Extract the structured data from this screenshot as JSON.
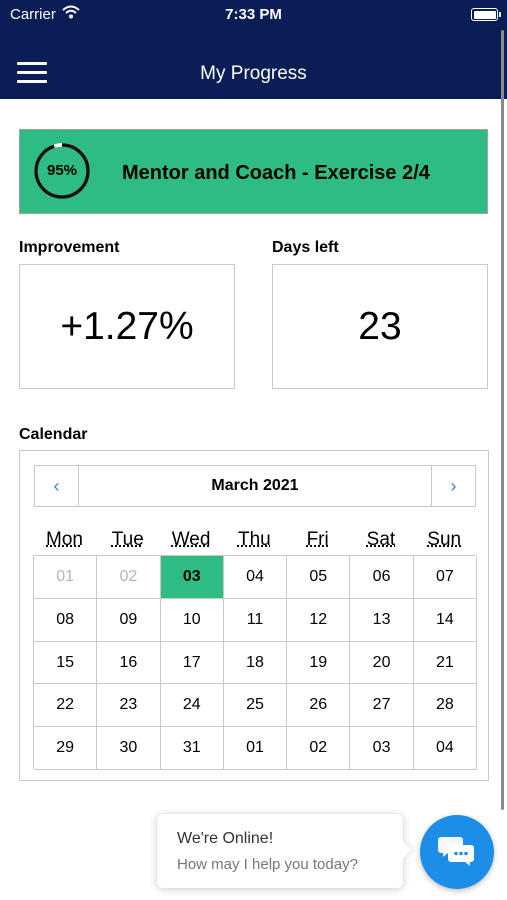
{
  "status_bar": {
    "carrier": "Carrier",
    "time": "7:33 PM"
  },
  "nav": {
    "title": "My Progress",
    "menu_icon": "hamburger-menu-icon"
  },
  "banner": {
    "progress_percent": 95,
    "progress_label": "95%",
    "title": "Mentor and Coach - Exercise 2/4",
    "color": "#2ebc83"
  },
  "stats": {
    "improvement": {
      "label": "Improvement",
      "value": "+1.27%"
    },
    "days_left": {
      "label": "Days left",
      "value": "23"
    }
  },
  "calendar": {
    "label": "Calendar",
    "month": "March 2021",
    "prev": "‹",
    "next": "›",
    "weekdays": [
      "Mon",
      "Tue",
      "Wed",
      "Thu",
      "Fri",
      "Sat",
      "Sun"
    ],
    "weeks": [
      [
        "01",
        "02",
        "03",
        "04",
        "05",
        "06",
        "07"
      ],
      [
        "08",
        "09",
        "10",
        "11",
        "12",
        "13",
        "14"
      ],
      [
        "15",
        "16",
        "17",
        "18",
        "19",
        "20",
        "21"
      ],
      [
        "22",
        "23",
        "24",
        "25",
        "26",
        "27",
        "28"
      ],
      [
        "29",
        "30",
        "31",
        "01",
        "02",
        "03",
        "04"
      ]
    ],
    "selected_day": "03",
    "disabled_days": [
      "01",
      "02"
    ]
  },
  "chat": {
    "line1": "We're Online!",
    "line2": "How may I help you today?",
    "icon": "chat-bubbles-icon"
  }
}
